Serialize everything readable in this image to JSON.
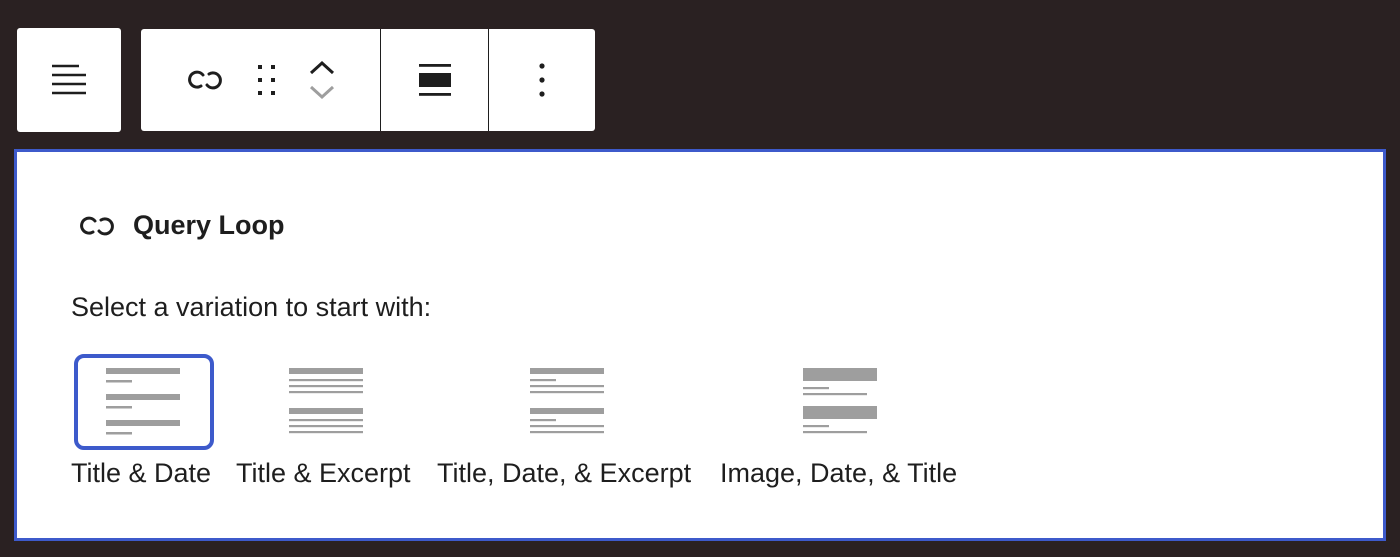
{
  "toolbar": {
    "paragraph_icon": "align-left-icon",
    "block_icon": "loop-icon",
    "drag_icon": "drag-handle-icon",
    "move_up_icon": "chevron-up-icon",
    "move_down_icon": "chevron-down-icon",
    "align_icon": "align-wide-icon",
    "more_icon": "more-vertical-icon"
  },
  "panel": {
    "title": "Query Loop",
    "title_icon": "loop-icon",
    "instructions": "Select a variation to start with:",
    "variations": [
      {
        "label": "Title & Date",
        "selected": true
      },
      {
        "label": "Title & Excerpt",
        "selected": false
      },
      {
        "label": "Title, Date, & Excerpt",
        "selected": false
      },
      {
        "label": "Image, Date, & Title",
        "selected": false
      }
    ]
  },
  "colors": {
    "background": "#2a2122",
    "accent": "#3d5acb",
    "text": "#1e1e1e",
    "icon_gray": "#9e9e9e"
  }
}
